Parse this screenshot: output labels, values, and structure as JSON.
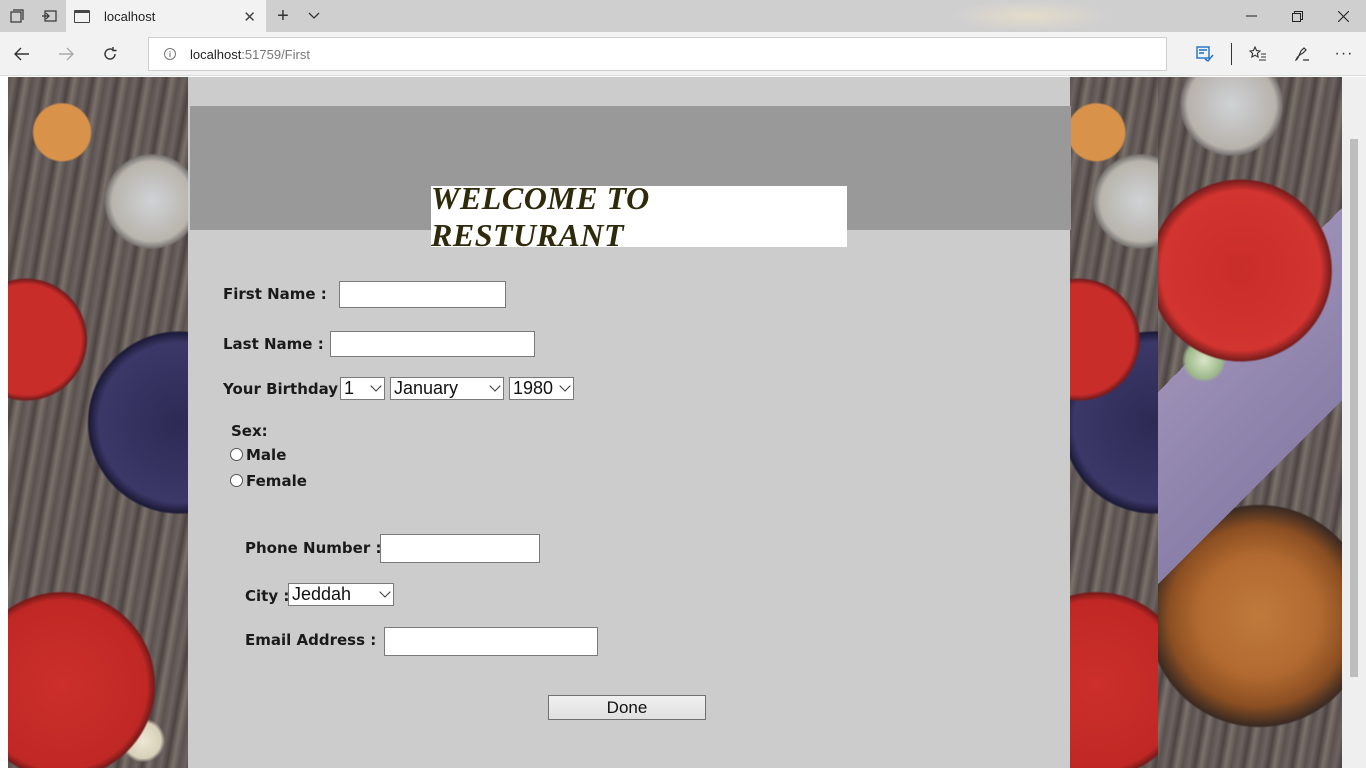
{
  "browser": {
    "tab_title": "localhost",
    "url_host": "localhost",
    "url_path": ":51759/First"
  },
  "page": {
    "title": "WELCOME TO RESTURANT",
    "form": {
      "first_name_label": "First Name :",
      "first_name_value": "",
      "last_name_label": "Last Name :",
      "last_name_value": "",
      "birthday_label": "Your Birthday :",
      "birthday_day": "1",
      "birthday_month": "January",
      "birthday_year": "1980",
      "sex_label": "Sex:",
      "sex_options": [
        "Male",
        "Female"
      ],
      "phone_label": "Phone Number :",
      "phone_value": "",
      "city_label": "City :",
      "city_value": "Jeddah",
      "email_label": "Email Address :",
      "email_value": "",
      "submit_label": "Done"
    }
  },
  "colors": {
    "panel_bg": "#cccccc",
    "header_band": "#999999",
    "title_color": "#2e2a0b"
  },
  "icons": {
    "tab_actions": [
      "tab-set-aside-icon",
      "tabs-preview-icon"
    ],
    "window": [
      "minimize-icon",
      "restore-icon",
      "close-icon"
    ],
    "nav": [
      "back-icon",
      "forward-icon",
      "refresh-icon"
    ],
    "toolbar": [
      "reading-view-icon",
      "favorites-icon",
      "web-note-icon",
      "more-icon"
    ]
  }
}
